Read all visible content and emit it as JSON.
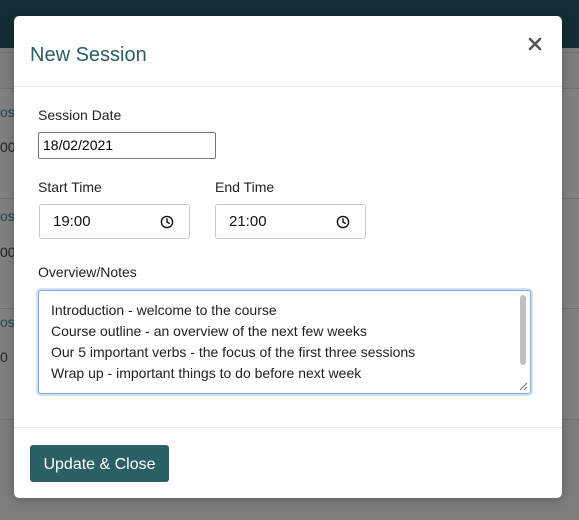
{
  "background": {
    "header_color": "#122e33",
    "fragments": [
      {
        "text": "ost",
        "dark": false
      },
      {
        "text": "00",
        "dark": true
      },
      {
        "text": "ost",
        "dark": false
      },
      {
        "text": "00",
        "dark": true
      },
      {
        "text": "ost",
        "dark": false
      },
      {
        "text": "0",
        "dark": true
      }
    ]
  },
  "modal": {
    "title": "New Session",
    "close_icon": "close-icon",
    "accent_color": "#2b5f66",
    "session_date": {
      "label": "Session Date",
      "value": "18/02/2021"
    },
    "start_time": {
      "label": "Start Time",
      "value": "19:00",
      "icon": "clock-icon"
    },
    "end_time": {
      "label": "End Time",
      "value": "21:00",
      "icon": "clock-icon"
    },
    "notes": {
      "label": "Overview/Notes",
      "value": "Introduction - welcome to the course\nCourse outline - an overview of the next few weeks\nOur 5 important verbs - the focus of the first three sessions\nWrap up - important things to do before next week"
    },
    "submit_label": "Update & Close"
  }
}
